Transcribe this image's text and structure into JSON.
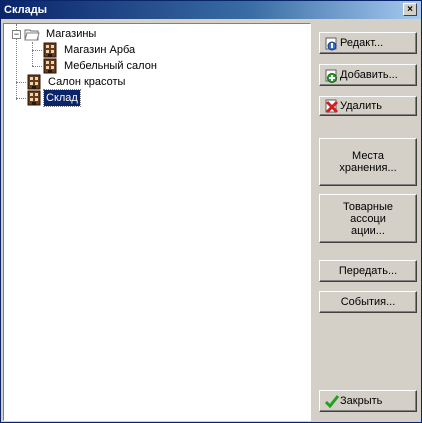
{
  "window": {
    "title": "Склады",
    "close_glyph": "×"
  },
  "tree": {
    "nodes": [
      {
        "label": "Магазины",
        "icon": "open-folder-icon",
        "expander": "−"
      },
      {
        "label": "Магазин Арба",
        "icon": "warehouse-icon"
      },
      {
        "label": "Мебельный салон",
        "icon": "warehouse-icon"
      },
      {
        "label": "Салон красоты",
        "icon": "warehouse-icon"
      },
      {
        "label": "Склад",
        "icon": "warehouse-icon",
        "selected": true
      }
    ]
  },
  "buttons": {
    "edit": "Редакт...",
    "add": "Добавить...",
    "delete": "Удалить",
    "storage_places_1": "Места",
    "storage_places_2": "хранения...",
    "product_assoc_1": "Товарные",
    "product_assoc_2": "ассоци",
    "product_assoc_3": "ации...",
    "transfer": "Передать...",
    "events": "События...",
    "close": "Закрыть"
  },
  "colors": {
    "titlebar": "#0a246a",
    "face": "#d4d0c8",
    "selection": "#0a246a"
  }
}
